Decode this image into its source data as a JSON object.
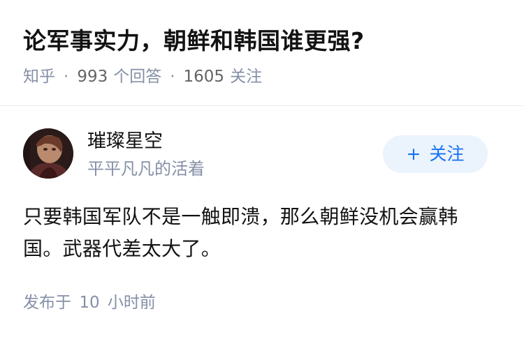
{
  "question": {
    "title": "论军事实力，朝鲜和韩国谁更强?",
    "source": "知乎",
    "answer_count": "993",
    "answer_count_label": "个回答",
    "follower_count": "1605",
    "follower_label": "关注",
    "separator": "·"
  },
  "answer": {
    "author": {
      "name": "璀璨星空",
      "bio": "平平凡凡的活着",
      "avatar_icon": "avatar-image"
    },
    "follow_button": {
      "icon": "+",
      "label": "关注"
    },
    "content_line1": "只要韩国军队不是一触即溃，那么朝鲜没机会赢韩",
    "content_line2": "国。武器代差太大了。",
    "published": {
      "prefix": "发布于",
      "value": "10",
      "unit": "小时前"
    }
  },
  "colors": {
    "primary_text": "#121212",
    "secondary_text": "#8590a6",
    "accent": "#1772f6",
    "accent_bg": "#ebf3fc",
    "divider": "#ebebeb"
  }
}
